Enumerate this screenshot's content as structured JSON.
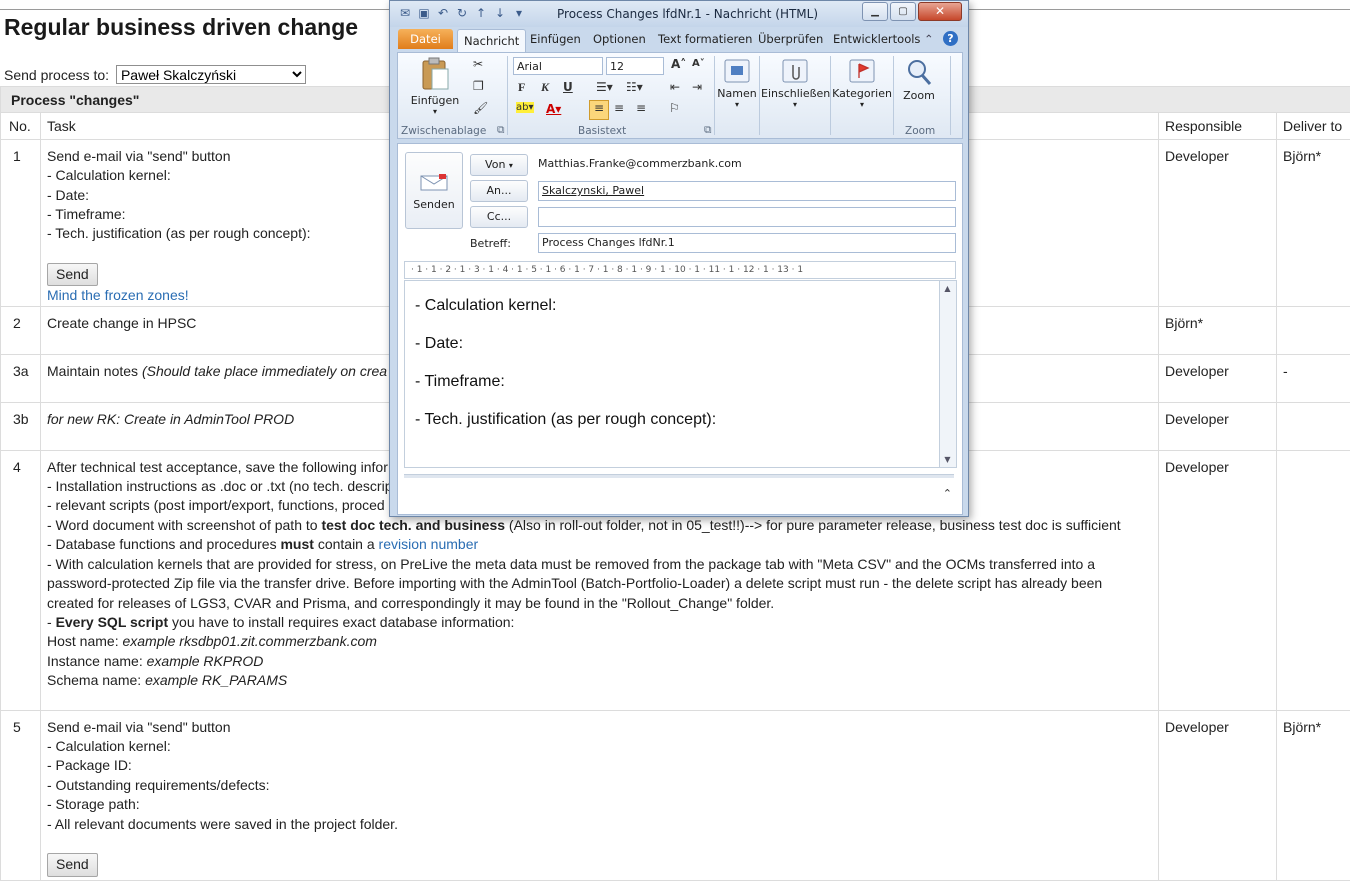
{
  "page": {
    "title": "Regular business driven change",
    "send_label": "Send process to:",
    "send_selected": "Paweł Skalczyński",
    "section_title": "Process \"changes\"",
    "headers": {
      "no": "No.",
      "task": "Task",
      "responsible": "Responsible",
      "deliver": "Deliver to"
    }
  },
  "rows": [
    {
      "no": "1",
      "responsible": "Developer",
      "deliver": "Björn*",
      "lines": [
        "Send e-mail via \"send\" button",
        "- Calculation kernel:",
        "- Date:",
        "- Timeframe:",
        "- Tech. justification (as per rough concept):"
      ],
      "button": "Send",
      "link": "Mind the frozen zones!"
    },
    {
      "no": "2",
      "responsible": "Björn*",
      "deliver": "",
      "lines": [
        "Create change in HPSC"
      ]
    },
    {
      "no": "3a",
      "responsible": "Developer",
      "deliver": "-",
      "text": "Maintain notes ",
      "italic": "(Should take place immediately on crea"
    },
    {
      "no": "3b",
      "responsible": "Developer",
      "deliver": "",
      "italic": "for new RK: Create in AdminTool PROD"
    },
    {
      "no": "4",
      "responsible": "Developer",
      "deliver": "",
      "l1": "After technical test acceptance, save the following infor",
      "l2": "- Installation instructions as .doc or .txt (no tech. descrip",
      "l3": "- relevant scripts (post import/export, functions, proced",
      "l4a": "- Word document with screenshot of path to ",
      "l4b": "test doc tech. and business",
      "l4c": " (Also in roll-out folder, not in 05_test!!)--> for pure parameter release, business test doc is sufficient",
      "l5a": "- Database functions and procedures ",
      "l5b": "must",
      "l5c": " contain a ",
      "l5d": "revision number",
      "l6": "- With calculation kernels that are provided for stress, on PreLive the meta data must be removed from the package tab with \"Meta CSV\" and the OCMs transferred into a",
      "l7": "password-protected Zip file via the transfer drive. Before importing with the AdminTool (Batch-Portfolio-Loader) a delete script must run - the delete script has already been",
      "l8": "created for releases of LGS3, CVAR and Prisma, and correspondingly it may be found in the \"Rollout_Change\" folder.",
      "l9a": "- ",
      "l9b": "Every SQL script",
      "l9c": " you have to install requires exact database information:",
      "l10a": "Host name: ",
      "l10b": "example rksdbp01.zit.commerzbank.com",
      "l11a": "Instance name: ",
      "l11b": "example RKPROD",
      "l12a": "Schema name: ",
      "l12b": "example RK_PARAMS"
    },
    {
      "no": "5",
      "responsible": "Developer",
      "deliver": "Björn*",
      "lines": [
        "Send e-mail via \"send\" button",
        "- Calculation kernel:",
        "- Package ID:",
        "- Outstanding requirements/defects:",
        "- Storage path:",
        "- All relevant documents were saved in the project folder."
      ],
      "button": "Send"
    }
  ],
  "outlook": {
    "title": "Process Changes lfdNr.1  -  Nachricht (HTML)",
    "tabs": [
      "Datei",
      "Nachricht",
      "Einfügen",
      "Optionen",
      "Text formatieren",
      "Überprüfen",
      "Entwicklertools"
    ],
    "ribbon": {
      "paste": "Einfügen",
      "clipboard_group": "Zwischenablage",
      "font": "Arial",
      "font_size": "12",
      "basictext_group": "Basistext",
      "names": "Namen",
      "attach": "Einschließen",
      "categories": "Kategorien",
      "zoom": "Zoom",
      "zoom_group": "Zoom"
    },
    "send_button": "Senden",
    "from_button": "Von",
    "from_value": "Matthias.Franke@commerzbank.com",
    "to_button": "An...",
    "to_value": "Skalczynski, Pawel",
    "cc_button": "Cc...",
    "cc_value": "",
    "subject_label": "Betreff:",
    "subject_value": "Process Changes lfdNr.1",
    "ruler": "· 1 · 1 · 2 · 1 · 3 · 1 · 4 · 1 · 5 · 1 · 6 · 1 · 7 · 1 · 8 · 1 · 9 · 1 · 10 · 1 · 11 · 1 · 12 · 1 · 13 · 1",
    "body": [
      "- Calculation kernel:",
      "- Date:",
      "- Timeframe:",
      "- Tech. justification (as per rough concept):"
    ]
  }
}
